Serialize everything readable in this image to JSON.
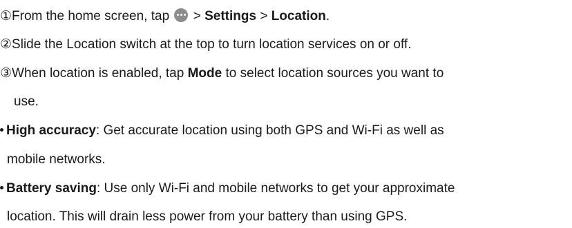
{
  "steps": [
    {
      "num": "①",
      "pre": "From the home screen, tap ",
      "icon": "apps-icon",
      "mid": " > ",
      "settings": "Settings",
      "sep": " > ",
      "location": "Location",
      "end": "."
    },
    {
      "num": "②",
      "text": "Slide the Location switch at the top to turn location services on or off."
    },
    {
      "num": "③",
      "pre": "When location is enabled, tap ",
      "mode": "Mode",
      "post": " to select location sources you want to",
      "cont": "use."
    }
  ],
  "bullets": [
    {
      "term": "High accuracy",
      "line1": ": Get accurate location using both GPS and Wi-Fi as well as",
      "line2": "mobile networks."
    },
    {
      "term": "Battery saving",
      "line1": ": Use only Wi-Fi and mobile networks to get your approximate",
      "line2": "location. This will drain less power from your battery than using GPS."
    }
  ]
}
